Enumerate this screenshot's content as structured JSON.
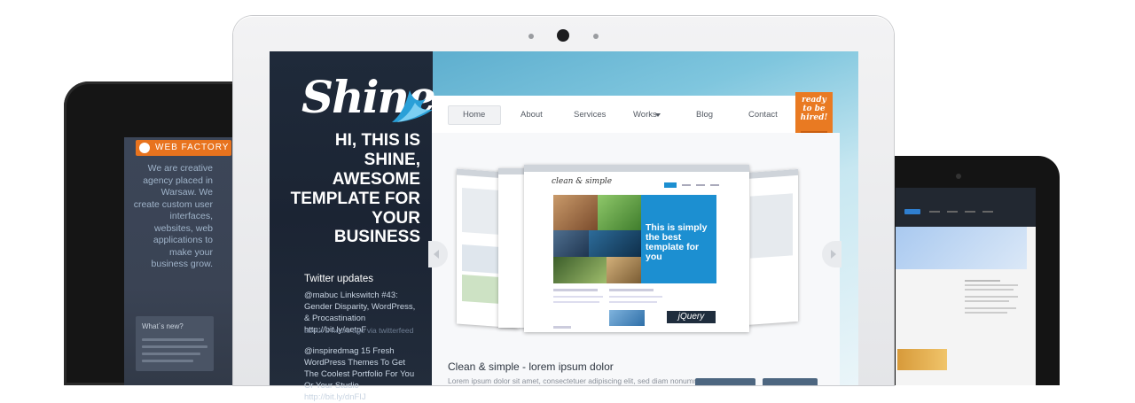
{
  "left_tablet": {
    "logo": "WEB FACTORY",
    "description": "We are creative agency placed in Warsaw. We create custom user interfaces, websites, web applications to make your business grow.",
    "news_title": "What`s new?"
  },
  "brand": {
    "logo": "Shine",
    "hero": [
      "HI, THIS IS",
      "SHINE,",
      "AWESOME",
      "TEMPLATE FOR",
      "YOUR",
      "BUSINESS"
    ]
  },
  "nav": {
    "items": [
      "Home",
      "About",
      "Services",
      "Works",
      "Blog",
      "Contact"
    ]
  },
  "hire": {
    "text": "ready to be hired!"
  },
  "twitter": {
    "title": "Twitter updates",
    "tweets": [
      {
        "text": "@mabuc Linkswitch #43: Gender Disparity, WordPress, & Procastination http://bit.ly/aetpF",
        "time": "about 2 hours ago via twitterfeed"
      },
      {
        "text": "@inspiredmag 15 Fresh WordPress Themes To Get The Coolest Portfolio For You Or Your Studio http://bit.ly/dnFIJ"
      }
    ]
  },
  "slider": {
    "mini_logo": "clean & simple",
    "headline": "This is simply the best template for you",
    "jquery": "jQuery"
  },
  "content": {
    "caption": "Clean & simple - lorem ipsum dolor",
    "lorem": "Lorem ipsum dolor sit amet, consectetuer adipiscing elit, sed diam nonummy"
  },
  "colors": {
    "accent": "#e97a22",
    "sidebar": "#1f2a3a",
    "mini_blue": "#1c8fd1"
  }
}
